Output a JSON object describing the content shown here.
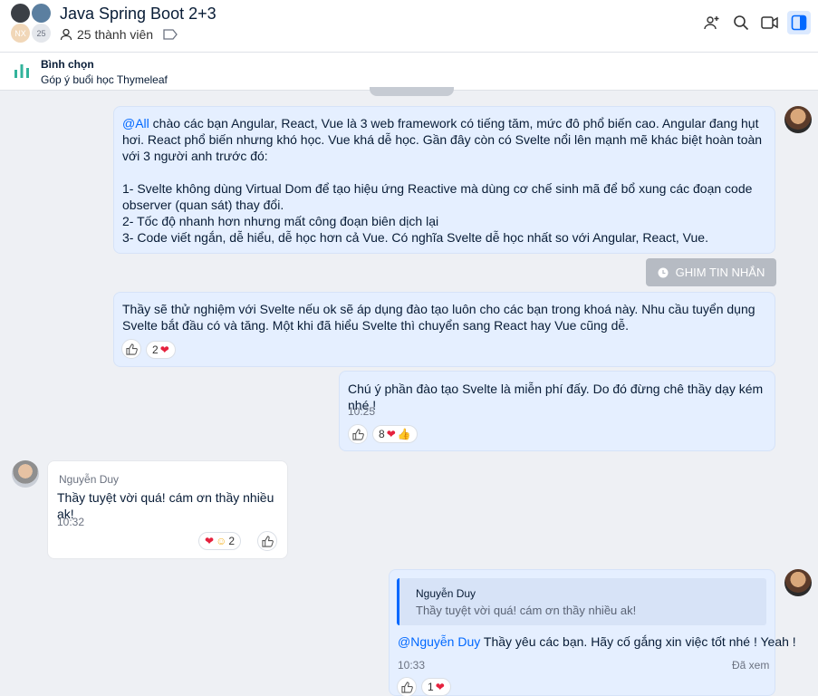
{
  "header": {
    "title": "Java Spring Boot 2+3",
    "members": "25 thành viên",
    "avatar_initials": "NX",
    "avatar_count": "25"
  },
  "pinned": {
    "title": "Bình chọn",
    "subtitle": "Góp ý buổi học Thymeleaf"
  },
  "messages": {
    "m1": {
      "mention": "@All",
      "text": " chào các bạn Angular, React, Vue là 3 web framework có tiếng tăm, mức đô phổ biến cao. Angular đang hụt hơi. React phổ biến nhưng khó học. Vue khá dễ học. Gần đây còn có Svelte nổi lên mạnh mẽ khác biệt hoàn toàn với 3 người anh trước đó:",
      "list": [
        "1- Svelte không dùng Virtual Dom để tạo hiệu ứng Reactive mà dùng cơ chế sinh mã để bổ xung các đoạn code observer (quan sát) thay đổi.",
        "2- Tốc độ nhanh hơn nhưng mất công đoạn biên dịch lại",
        "3- Code viết ngắn, dễ hiểu, dễ học hơn cả Vue. Có nghĩa Svelte dễ học nhất so với Angular, React, Vue."
      ]
    },
    "pin_button": "GHIM TIN NHẮN",
    "m2": {
      "text": "Thầy sẽ thử nghiệm với Svelte nếu ok sẽ áp dụng đào tạo luôn cho các bạn trong khoá này. Nhu cầu tuyển dụng Svelte bắt đầu có và tăng. Một khi đã hiểu Svelte thì chuyển sang React hay Vue cũng dễ.",
      "reaction_count": "2"
    },
    "m3": {
      "text": "Chú ý phần đào tạo Svelte là miễn phí đấy. Do đó đừng chê thầy dạy kém nhé !",
      "time": "10:25",
      "reaction_count": "8"
    },
    "m4": {
      "sender": "Nguyễn Duy",
      "text": "Thầy tuyệt vời quá! cám ơn thầy nhiều ak!",
      "time": "10:32",
      "reaction_count": "2"
    },
    "m5": {
      "quote_name": "Nguyễn Duy",
      "quote_text": "Thầy tuyệt vời quá! cám ơn thầy nhiều ak!",
      "mention": "@Nguyễn Duy",
      "text": " Thầy yêu các bạn. Hãy cố gắng xin việc tốt nhé ! Yeah !",
      "time": "10:33",
      "seen": "Đã xem",
      "reaction_count": "1"
    }
  },
  "colors": {
    "accent": "#0068ff",
    "my_bubble": "#e5efff",
    "heart": "#e5213d"
  }
}
